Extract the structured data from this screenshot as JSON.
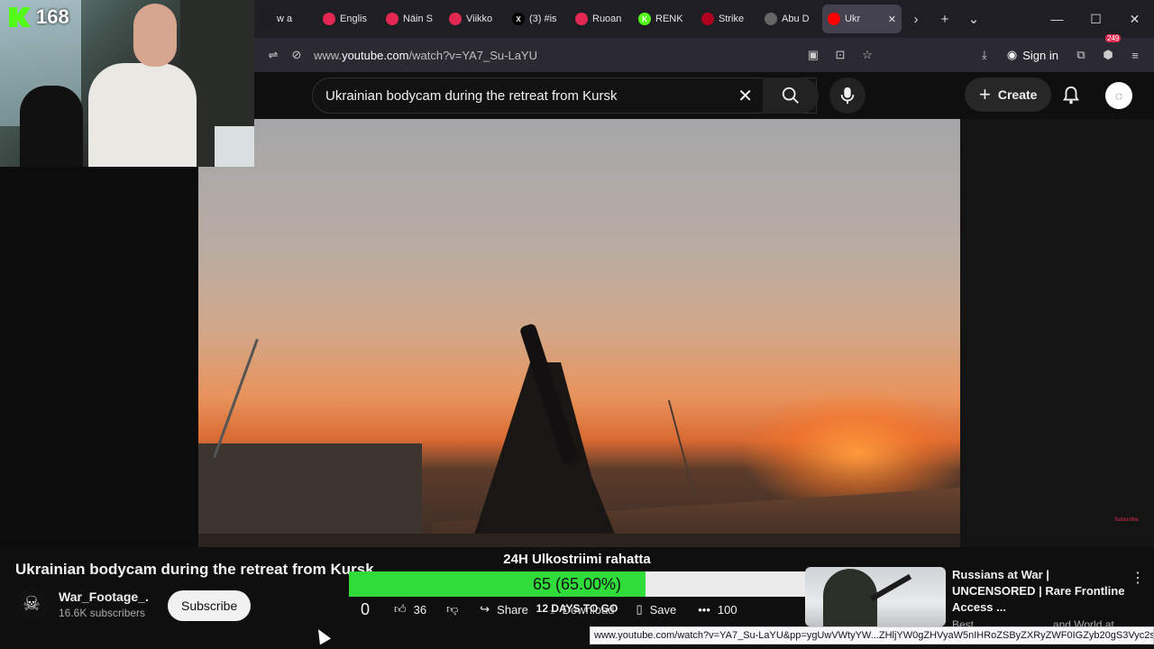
{
  "stream": {
    "kick_viewers": "168"
  },
  "browser": {
    "tabs": [
      {
        "label": "w a",
        "color": "#1f1e25",
        "glyph": ""
      },
      {
        "label": "Englis",
        "color": "#e22850",
        "glyph": ""
      },
      {
        "label": "Näin S",
        "color": "#e22850",
        "glyph": ""
      },
      {
        "label": "Viikko",
        "color": "#e22850",
        "glyph": ""
      },
      {
        "label": "(3) #is",
        "color": "#000000",
        "glyph": "X"
      },
      {
        "label": "Ruoan",
        "color": "#e22850",
        "glyph": ""
      },
      {
        "label": "RENK",
        "color": "#53fc18",
        "glyph": "K"
      },
      {
        "label": "Strike",
        "color": "#b00020",
        "glyph": ""
      },
      {
        "label": "Abu D",
        "color": "#666666",
        "glyph": ""
      },
      {
        "label": "Ukr",
        "color": "#ff0000",
        "glyph": ""
      }
    ],
    "url_prefix": "www.",
    "url_domain": "youtube.com",
    "url_path": "/watch?v=YA7_Su-LaYU",
    "sign_in": "Sign in",
    "extension_badge": "249"
  },
  "youtube": {
    "search_query": "Ukrainian bodycam during the retreat from Kursk",
    "create_label": "Create",
    "video_title": "Ukrainian bodycam during the retreat from Kursk",
    "channel_name": "War_Footage_.",
    "subscribers": "16.6K subscribers",
    "subscribe_label": "Subscribe",
    "dislike_count": "0",
    "like_count": "36",
    "share_label": "Share",
    "download_label": "Download",
    "save_label": "Save",
    "more_count": "100",
    "subscribe_watermark": "Subscribe"
  },
  "goal": {
    "title": "24H Ulkostriimi rahatta",
    "progress_text": "65 (65.00%)",
    "progress": 0.65,
    "days_left": "12 DAYS TO GO"
  },
  "recommended": {
    "title": "Russians at War | UNCENSORED | Rare Frontline Access ...",
    "channel": "Best Documentary",
    "channel_extra": "and World at War"
  },
  "status_url": "www.youtube.com/watch?v=YA7_Su-LaYU&pp=ygUwVWtyYW...ZHljYW0gZHVyaW5nIHRoZSByZXRyZWF0IGZyb20gS3Vyc2sg",
  "colors": {
    "accent_green": "#2fdc3a",
    "kick_green": "#53fc18",
    "yt_red": "#ff0000"
  }
}
